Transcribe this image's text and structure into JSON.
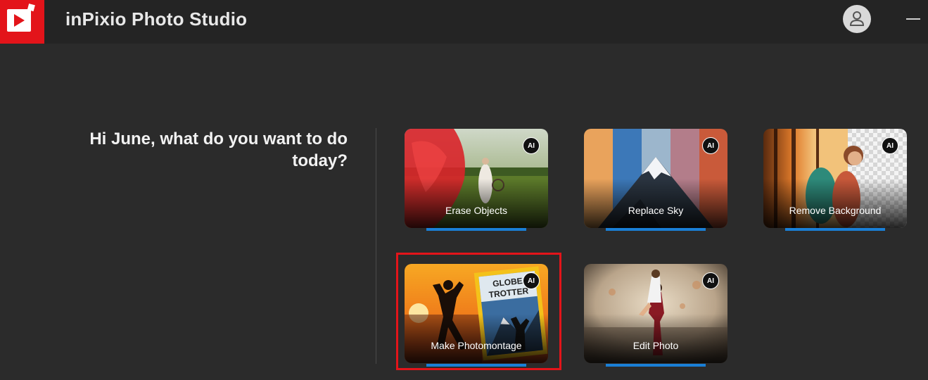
{
  "app": {
    "title": "inPixio Photo Studio"
  },
  "greeting": {
    "line1": "Hi June, what do you want to do",
    "line2": "today?"
  },
  "cards": [
    {
      "label": "Erase Objects",
      "badge": "AI"
    },
    {
      "label": "Replace Sky",
      "badge": "AI"
    },
    {
      "label": "Remove Background",
      "badge": "AI"
    },
    {
      "label": "Make Photomontage",
      "badge": "AI",
      "selected": true
    },
    {
      "label": "Edit Photo",
      "badge": "AI"
    }
  ],
  "icons": {
    "logo": "play-logo-icon",
    "user": "user-icon",
    "minimize": "minimize-icon"
  },
  "colors": {
    "brand": "#e3141a",
    "accent_bar": "#1a7fd6",
    "background": "#2b2b2b",
    "titlebar": "#242424"
  }
}
